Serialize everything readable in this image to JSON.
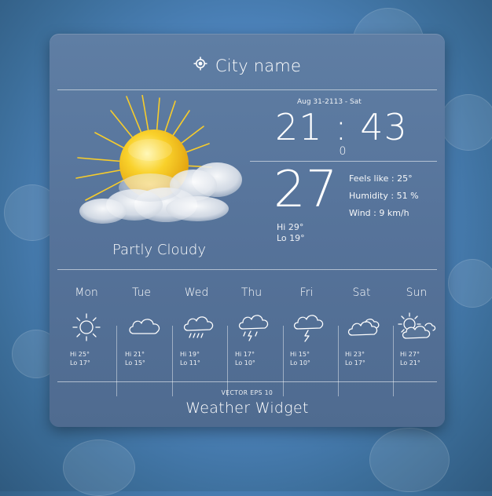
{
  "header": {
    "city": "City name",
    "icon": "location-target-icon"
  },
  "current": {
    "date": "Aug 31-2113 - Sat",
    "time": "21 : 43",
    "temperature": "27",
    "degree": "0",
    "hi": "Hi 29°",
    "lo": "Lo 19°",
    "feels_like": "Feels like : 25°",
    "humidity": "Humidity : 51 %",
    "wind": "Wind : 9 km/h",
    "condition": "Partly Cloudy",
    "icon": "sun-cloud-icon"
  },
  "forecast": [
    {
      "day": "Mon",
      "icon": "sun-icon",
      "hi": "Hi   25°",
      "lo": "Lo   17°"
    },
    {
      "day": "Tue",
      "icon": "cloud-icon",
      "hi": "Hi   21°",
      "lo": "Lo   15°"
    },
    {
      "day": "Wed",
      "icon": "rain-cloud-icon",
      "hi": "Hi   19°",
      "lo": "Lo   11°"
    },
    {
      "day": "Thu",
      "icon": "storm-cloud-icon",
      "hi": "Hi   17°",
      "lo": "Lo   10°"
    },
    {
      "day": "Fri",
      "icon": "lightning-cloud-icon",
      "hi": "Hi   15°",
      "lo": "Lo   10°"
    },
    {
      "day": "Sat",
      "icon": "cloudy-icon",
      "hi": "Hi   23°",
      "lo": "Lo   17°"
    },
    {
      "day": "Sun",
      "icon": "sun-cloud-outline-icon",
      "hi": "Hi   27°",
      "lo": "Lo   21°"
    }
  ],
  "footer": {
    "small": "VECTOR EPS 10",
    "title": "Weather Widget"
  },
  "colors": {
    "panel": "#56739a",
    "background": "#4f86c0",
    "sun": "#f6c21b"
  }
}
